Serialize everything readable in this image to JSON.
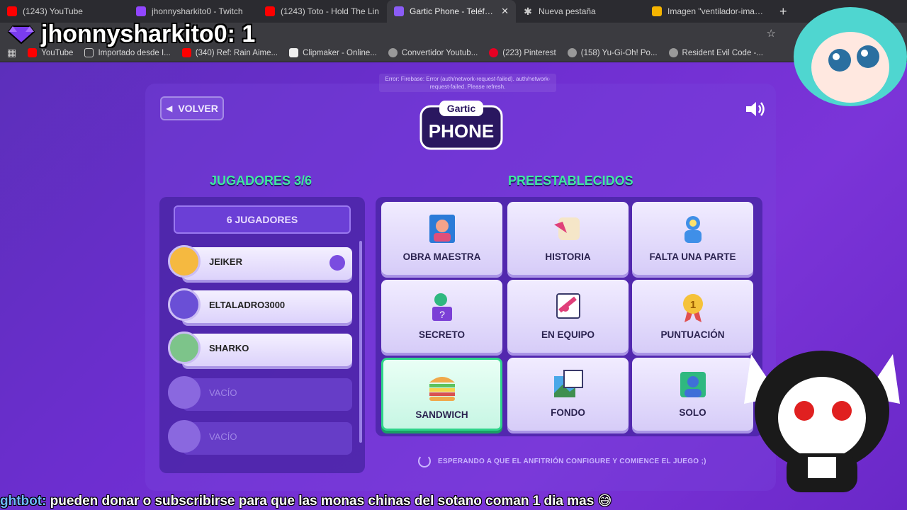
{
  "browser": {
    "tabs": [
      {
        "label": "(1243) YouTube",
        "icon": "youtube-icon",
        "color": "#ff0000"
      },
      {
        "label": "jhonnysharkito0 - Twitch",
        "icon": "twitch-icon",
        "color": "#9146ff"
      },
      {
        "label": "(1243) Toto - Hold The Lin",
        "icon": "youtube-icon",
        "color": "#ff0000"
      },
      {
        "label": "Gartic Phone - Teléfono",
        "icon": "phone-icon",
        "color": "#8b5cf6",
        "active": true
      },
      {
        "label": "Nueva pestaña",
        "icon": "asterisk-icon",
        "color": "#bbbbbb"
      },
      {
        "label": "Imagen \"ventilador-imagen-",
        "icon": "star-icon",
        "color": "#f5b400"
      }
    ],
    "bookmarks": [
      {
        "label": "YouTube",
        "icon": "youtube-icon",
        "color": "#ff0000"
      },
      {
        "label": "Importado desde I...",
        "icon": "folder-icon",
        "color": "#cccccc"
      },
      {
        "label": "(340) Ref: Rain Aime...",
        "icon": "youtube-icon",
        "color": "#ff0000"
      },
      {
        "label": "Clipmaker - Online...",
        "icon": "clip-icon",
        "color": "#eeeeee"
      },
      {
        "label": "Convertidor Youtub...",
        "icon": "globe-icon",
        "color": "#aaaaaa"
      },
      {
        "label": "(223) Pinterest",
        "icon": "pinterest-icon",
        "color": "#e60023"
      },
      {
        "label": "(158) Yu-Gi-Oh! Po...",
        "icon": "globe-icon",
        "color": "#aaaaaa"
      },
      {
        "label": "Resident Evil Code -...",
        "icon": "globe-icon",
        "color": "#aaaaaa"
      }
    ]
  },
  "overlay": {
    "username_counter": "jhonnysharkito0: 1"
  },
  "game": {
    "error": "Error: Firebase: Error (auth/network-request-failed). auth/network-request-failed. Please refresh.",
    "back_label": "VOLVER",
    "logo_top": "Gartic",
    "logo_bottom": "PHONE",
    "players_title": "JUGADORES 3/6",
    "player_count_label": "6 JUGADORES",
    "players": [
      {
        "name": "JEIKER",
        "avatar_color": "#f5b940",
        "host": true
      },
      {
        "name": "ELTALADRO3000",
        "avatar_color": "#6a4fd6"
      },
      {
        "name": "SHARKO",
        "avatar_color": "#7dc48a"
      }
    ],
    "empty_slots": [
      "VACÍO",
      "VACÍO"
    ],
    "presets_title": "PREESTABLECIDOS",
    "presets": [
      {
        "label": "OBRA MAESTRA",
        "icon": "masterpiece-icon"
      },
      {
        "label": "HISTORIA",
        "icon": "scroll-icon"
      },
      {
        "label": "FALTA UNA PARTE",
        "icon": "missing-piece-icon"
      },
      {
        "label": "SECRETO",
        "icon": "secret-icon"
      },
      {
        "label": "EN EQUIPO",
        "icon": "team-icon"
      },
      {
        "label": "PUNTUACIÓN",
        "icon": "medal-icon"
      },
      {
        "label": "SANDWICH",
        "icon": "sandwich-icon",
        "selected": true
      },
      {
        "label": "FONDO",
        "icon": "background-icon"
      },
      {
        "label": "SOLO",
        "icon": "solo-icon"
      }
    ],
    "status": "ESPERANDO A QUE EL ANFITRIÓN CONFIGURE Y COMIENCE EL JUEGO ;)"
  },
  "chat": {
    "user": "ghtbot:",
    "message": " pueden donar o subscribirse para que las monas chinas del sotano coman 1 dia mas 😅"
  },
  "colors": {
    "accent_green": "#3fe8a0",
    "panel_purple": "#6b3fd6"
  }
}
